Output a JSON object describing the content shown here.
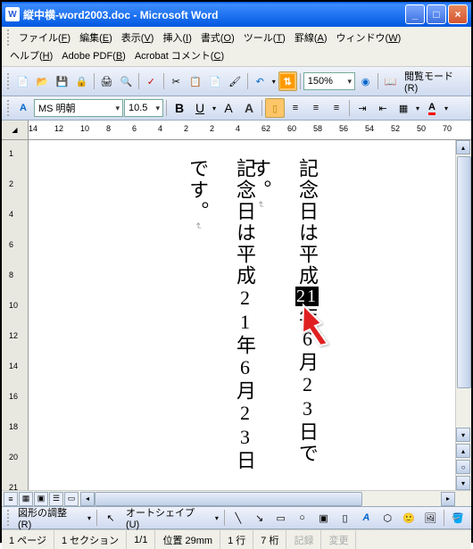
{
  "window": {
    "title": "縦中横-word2003.doc - Microsoft Word",
    "app_icon": "W"
  },
  "menu": {
    "row1": [
      {
        "label": "ファイル",
        "key": "F"
      },
      {
        "label": "編集",
        "key": "E"
      },
      {
        "label": "表示",
        "key": "V"
      },
      {
        "label": "挿入",
        "key": "I"
      },
      {
        "label": "書式",
        "key": "O"
      },
      {
        "label": "ツール",
        "key": "T"
      },
      {
        "label": "罫線",
        "key": "A"
      },
      {
        "label": "ウィンドウ",
        "key": "W"
      }
    ],
    "row2": [
      {
        "label": "ヘルプ",
        "key": "H"
      },
      {
        "label": "Adobe PDF",
        "key": "B"
      },
      {
        "label": "Acrobat コメント",
        "key": "C"
      }
    ]
  },
  "toolbar1": {
    "zoom": "150%",
    "reading_label": "閲覧モード(R)"
  },
  "toolbar2": {
    "font_name": "MS 明朝",
    "font_size": "10.5",
    "bold": "B",
    "underline": "U",
    "a1": "A",
    "a2": "A"
  },
  "ruler": {
    "nums": [
      "14",
      "12",
      "10",
      "8",
      "6",
      "4",
      "2",
      "2",
      "4",
      "62",
      "60",
      "58",
      "56",
      "54",
      "52",
      "50",
      "70"
    ]
  },
  "vruler": {
    "nums": [
      "1",
      "2",
      "4",
      "6",
      "8",
      "10",
      "12",
      "14",
      "16",
      "18",
      "20",
      "21"
    ]
  },
  "document": {
    "line1": "記念日は平成",
    "line1_highlight": "21",
    "line1_after": "年6月23日です。",
    "line2": "記念日は平成21年6月23日です。"
  },
  "btoolbar": {
    "shape_adjust": "図形の調整(R)",
    "autoshape": "オートシェイプ(U)"
  },
  "status": {
    "page": "1 ページ",
    "section": "1 セクション",
    "pageof": "1/1",
    "position": "位置 29mm",
    "line": "1 行",
    "col": "7 桁",
    "rec": "記録",
    "change": "変更"
  }
}
